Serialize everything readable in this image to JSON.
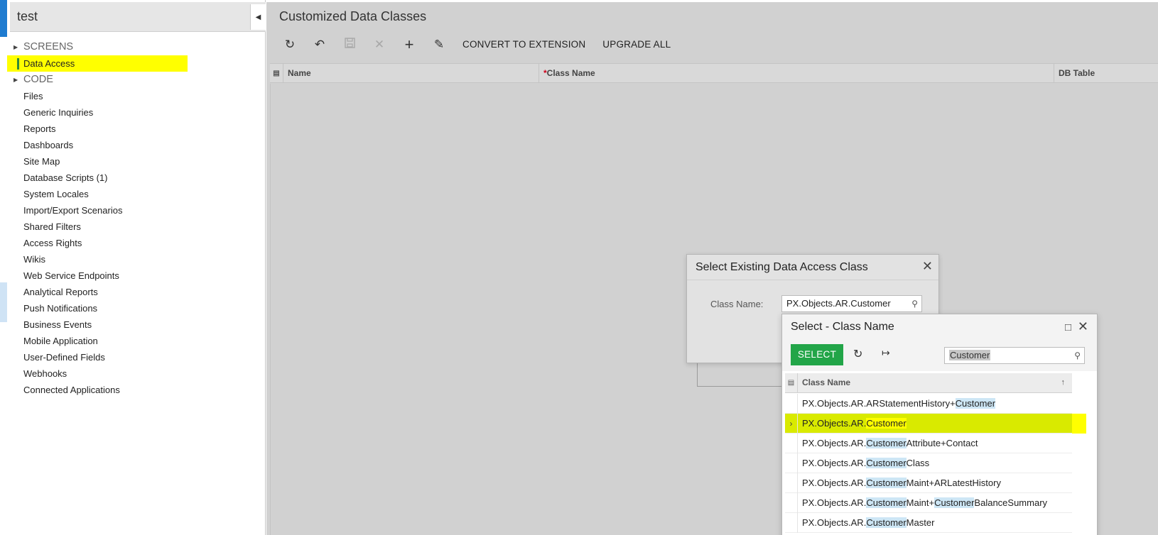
{
  "project": {
    "title": "test"
  },
  "sidebar": {
    "items": [
      {
        "label": "SCREENS",
        "group": true
      },
      {
        "label": "Data Access",
        "active": true
      },
      {
        "label": "CODE",
        "group": true
      },
      {
        "label": "Files"
      },
      {
        "label": "Generic Inquiries"
      },
      {
        "label": "Reports"
      },
      {
        "label": "Dashboards"
      },
      {
        "label": "Site Map"
      },
      {
        "label": "Database Scripts (1)"
      },
      {
        "label": "System Locales"
      },
      {
        "label": "Import/Export Scenarios"
      },
      {
        "label": "Shared Filters"
      },
      {
        "label": "Access Rights"
      },
      {
        "label": "Wikis"
      },
      {
        "label": "Web Service Endpoints"
      },
      {
        "label": "Analytical Reports"
      },
      {
        "label": "Push Notifications"
      },
      {
        "label": "Business Events"
      },
      {
        "label": "Mobile Application"
      },
      {
        "label": "User-Defined Fields"
      },
      {
        "label": "Webhooks"
      },
      {
        "label": "Connected Applications"
      }
    ]
  },
  "main": {
    "title": "Customized Data Classes",
    "toolbar": {
      "convert_label": "CONVERT TO EXTENSION",
      "upgrade_label": "UPGRADE ALL"
    },
    "grid": {
      "columns": [
        {
          "label": "Name",
          "required": false
        },
        {
          "label": "Class Name",
          "required": true
        },
        {
          "label": "DB Table",
          "required": false
        }
      ]
    }
  },
  "dialog_existing": {
    "title": "Select Existing Data Access Class",
    "field_label": "Class Name:",
    "field_value": "PX.Objects.AR.Customer"
  },
  "dialog_select": {
    "title": "Select - Class Name",
    "select_label": "SELECT",
    "search_value": "Customer",
    "column_header": "Class Name",
    "rows": [
      {
        "parts": [
          "PX.Objects.AR.ARStatementHistory+",
          "Customer",
          ""
        ]
      },
      {
        "parts": [
          "PX.Objects.AR.",
          "Customer",
          ""
        ],
        "selected": true
      },
      {
        "parts": [
          "PX.Objects.AR.",
          "Customer",
          "Attribute+Contact"
        ]
      },
      {
        "parts": [
          "PX.Objects.AR.",
          "Customer",
          "Class"
        ]
      },
      {
        "parts": [
          "PX.Objects.AR.",
          "Customer",
          "Maint+ARLatestHistory"
        ]
      },
      {
        "parts": [
          "PX.Objects.AR.",
          "Customer",
          "Maint+",
          "Customer",
          "BalanceSummary"
        ]
      },
      {
        "parts": [
          "PX.Objects.AR.",
          "Customer",
          "Master"
        ]
      }
    ]
  },
  "colors": {
    "highlight": "#ffff00",
    "select_green": "#22a548",
    "search_match": "#cde6f5",
    "brand_blue": "#1e7bd0"
  }
}
